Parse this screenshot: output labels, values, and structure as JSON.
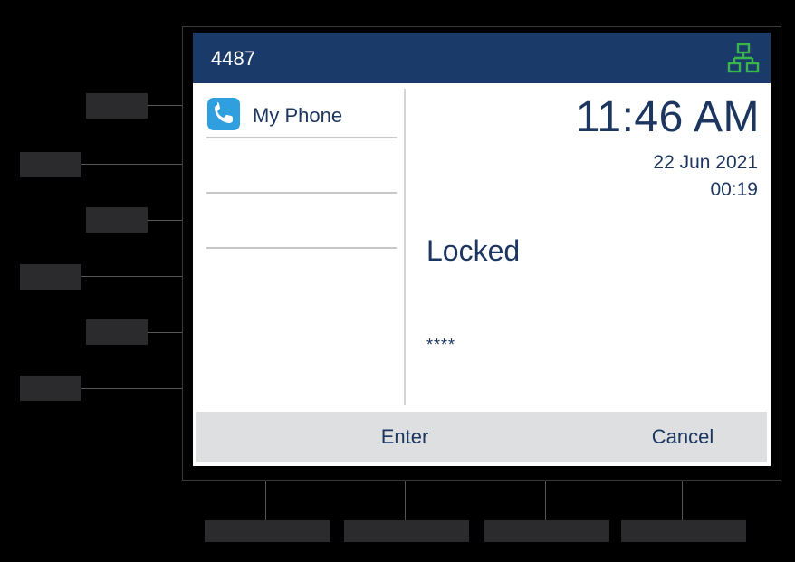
{
  "header": {
    "extension": "4487",
    "network_icon": "network-icon",
    "network_color": "#3ab54a"
  },
  "lines": {
    "items": [
      {
        "label": "My Phone",
        "icon": "phone-icon"
      },
      {
        "label": ""
      },
      {
        "label": ""
      }
    ]
  },
  "status": {
    "time": "11:46 AM",
    "date": "22 Jun 2021",
    "elapsed": "00:19"
  },
  "lock": {
    "title": "Locked",
    "pin_masked": "****"
  },
  "softkeys": {
    "enter_label": "Enter",
    "cancel_label": "Cancel"
  },
  "colors": {
    "header_bg": "#1a3a6a",
    "text": "#1c3660",
    "softkey_bar": "#dedfe1",
    "phone_icon": "#2f9fe0"
  }
}
